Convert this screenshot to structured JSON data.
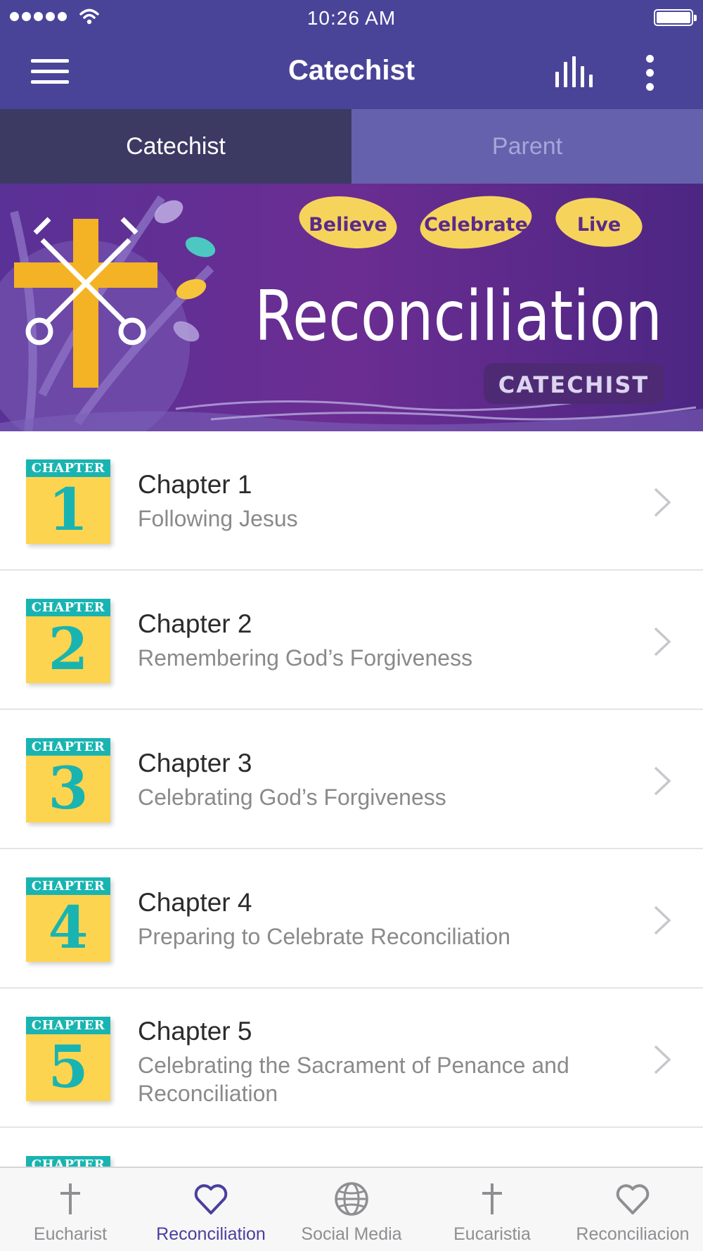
{
  "status_bar": {
    "time": "10:26 AM"
  },
  "nav": {
    "title": "Catechist"
  },
  "segments": [
    {
      "label": "Catechist",
      "active": true
    },
    {
      "label": "Parent",
      "active": false
    }
  ],
  "banner": {
    "leaves": [
      "Believe",
      "Celebrate",
      "Live"
    ],
    "title": "Reconciliation",
    "tag": "CATECHIST"
  },
  "chapters": [
    {
      "badge": "CHAPTER",
      "number": "1",
      "title": "Chapter 1",
      "subtitle": "Following Jesus"
    },
    {
      "badge": "CHAPTER",
      "number": "2",
      "title": "Chapter 2",
      "subtitle": "Remembering God’s Forgiveness"
    },
    {
      "badge": "CHAPTER",
      "number": "3",
      "title": "Chapter 3",
      "subtitle": "Celebrating God’s Forgiveness"
    },
    {
      "badge": "CHAPTER",
      "number": "4",
      "title": "Chapter 4",
      "subtitle": "Preparing to Celebrate Reconciliation"
    },
    {
      "badge": "CHAPTER",
      "number": "5",
      "title": "Chapter 5",
      "subtitle": "Celebrating the Sacrament of Penance and Reconciliation"
    },
    {
      "badge": "CHAPTER",
      "number": "",
      "title": "",
      "subtitle": ""
    }
  ],
  "tabbar": [
    {
      "label": "Eucharist",
      "icon": "cross-icon",
      "active": false
    },
    {
      "label": "Reconciliation",
      "icon": "heart-icon",
      "active": true
    },
    {
      "label": "Social Media",
      "icon": "globe-icon",
      "active": false
    },
    {
      "label": "Eucaristia",
      "icon": "cross-icon",
      "active": false
    },
    {
      "label": "Reconciliacion",
      "icon": "heart-icon",
      "active": false
    }
  ],
  "colors": {
    "nav_purple": "#4a4499",
    "segment_active": "#3c3a63",
    "segment_inactive": "#6661ad",
    "badge_teal": "#19b4b1",
    "badge_yellow": "#fdd44f",
    "tab_active": "#4a3f9e",
    "tab_inactive": "#8e8e93"
  }
}
